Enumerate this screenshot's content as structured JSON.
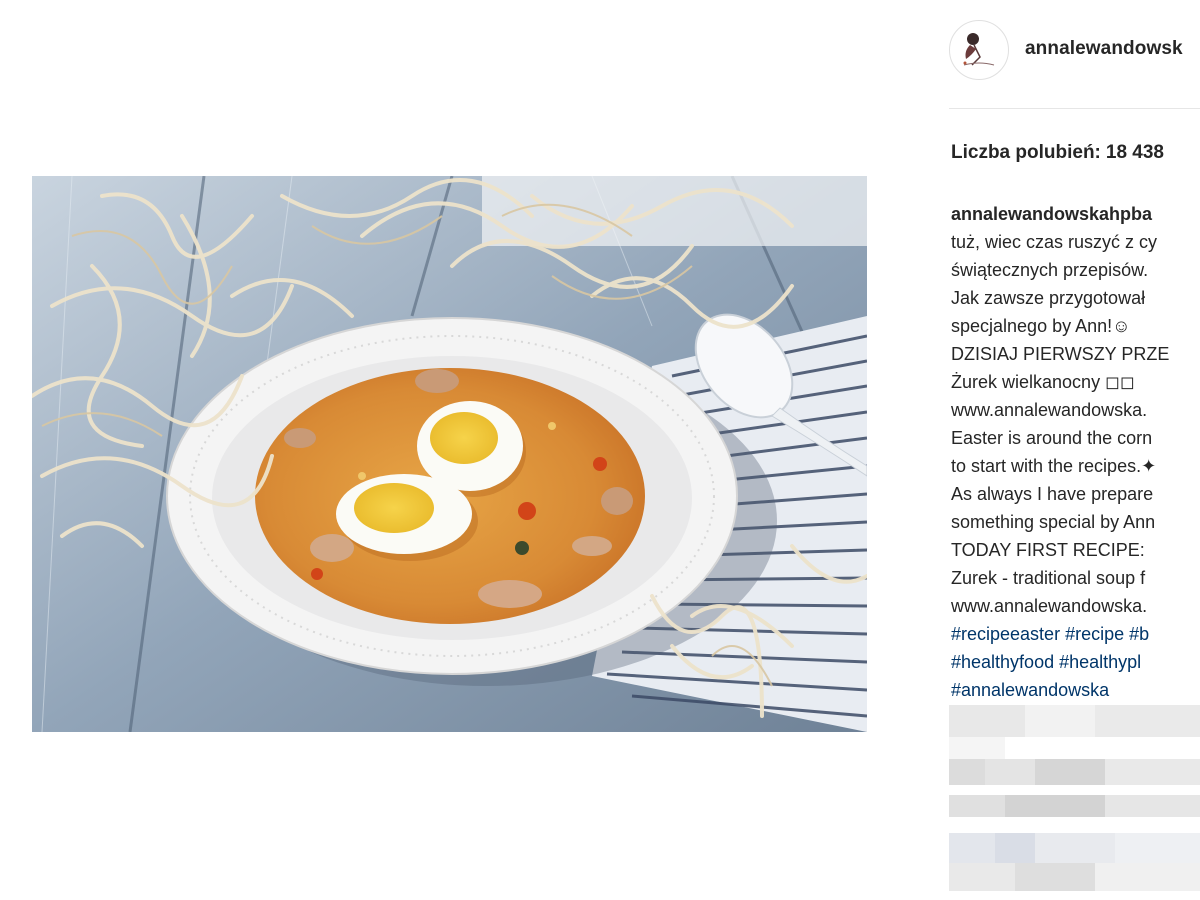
{
  "post": {
    "username": "annalewandowsk",
    "likes_label": "Liczba polubień:",
    "likes_count": "18 438",
    "photo_icon": "soup-photo"
  },
  "caption": {
    "author": "annalewandowskahpba",
    "lines": [
      "tuż, wiec czas ruszyć z cy",
      "świątecznych przepisów.",
      "Jak zawsze przygotował",
      "specjalnego by Ann!☺",
      "DZISIAJ PIERWSZY PRZE",
      "Żurek wielkanocny ◻◻",
      "www.annalewandowska.",
      "Easter is around the corn",
      "to start with the recipes.✦",
      "As always I have prepare",
      "something special by Ann",
      "TODAY FIRST RECIPE:",
      "Zurek - traditional soup f",
      "www.annalewandowska."
    ],
    "hashtag_lines": [
      [
        "#recipeeaster",
        "#recipe",
        "#b"
      ],
      [
        "#healthyfood",
        "#healthypl"
      ],
      [
        "#annalewandowska"
      ]
    ]
  },
  "icons": {
    "avatar": "avatar-logo-icon"
  }
}
